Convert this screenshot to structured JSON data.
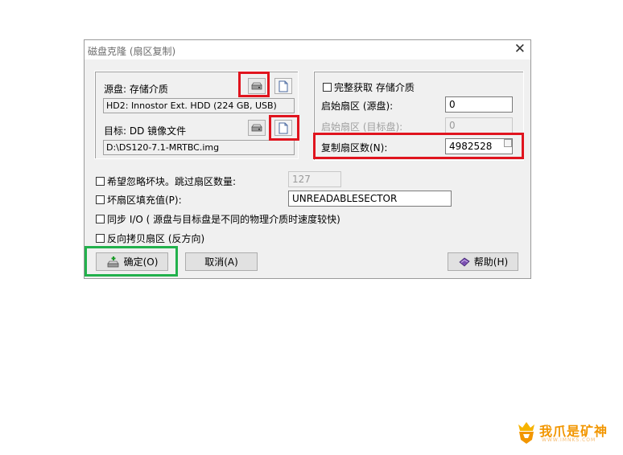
{
  "window": {
    "title": "磁盘克隆 (扇区复制)"
  },
  "source": {
    "label": "源盘: 存储介质",
    "value": "HD2: Innostor Ext. HDD (224 GB, USB)"
  },
  "target": {
    "label": "目标: DD 镜像文件",
    "value": "D:\\DS120-7.1-MRTBC.img"
  },
  "right_panel": {
    "full_capture_label": "完整获取 存储介质",
    "start_sector_source_label": "启始扇区 (源盘):",
    "start_sector_source_value": "0",
    "start_sector_target_label": "启始扇区 (目标盘):",
    "start_sector_target_value": "0",
    "copy_count_label": "复制扇区数(N):",
    "copy_count_value": "4982528"
  },
  "options": {
    "skip_bad_label": "希望忽略坏块。跳过扇区数量:",
    "skip_bad_value": "127",
    "bad_fill_label": "坏扇区填充值(P):",
    "bad_fill_value": "UNREADABLESECTOR",
    "sync_io_label": "同步 I/O ( 源盘与目标盘是不同的物理介质时速度较快)",
    "reverse_label": "反向拷贝扇区 (反方向)"
  },
  "buttons": {
    "ok": "确定(O)",
    "cancel": "取消(A)",
    "help": "帮助(H)"
  },
  "watermark": {
    "text": "我爪是矿神",
    "sub": "WWW.IMNKS.COM"
  },
  "colors": {
    "highlight_red": "#e0141e",
    "highlight_green": "#22b14c",
    "watermark": "#f29600"
  }
}
